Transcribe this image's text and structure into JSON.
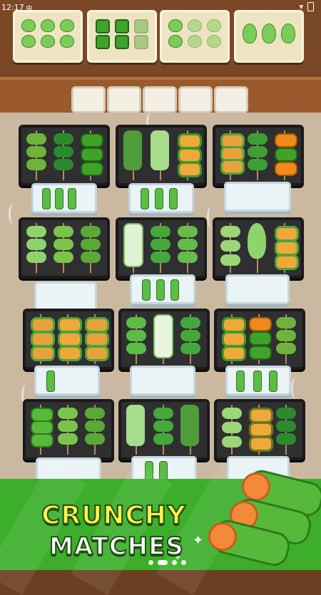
{
  "status_bar": {
    "time": "12:17",
    "carrier": "虫"
  },
  "banner": {
    "line1": "CRUNCHY",
    "line2": "MATCHES"
  },
  "order_cards": [
    {
      "item": "bok-choy-skewers",
      "color": "#9bd678"
    },
    {
      "item": "green-pepper-skewers",
      "color": "#3fa32a"
    },
    {
      "item": "bok-choy-skewers",
      "color": "#8fd36f"
    },
    {
      "item": "lettuce-skewers",
      "color": "#a4db86"
    }
  ],
  "empty_slots_count": 5,
  "pagination": {
    "pages": 4,
    "active": 1
  },
  "colors": {
    "wall": "#7a4727",
    "floor": "#cbb8a1",
    "tray": "#2f2f31",
    "banner": "#3cae2b",
    "title_yellow": "#fff24a"
  }
}
